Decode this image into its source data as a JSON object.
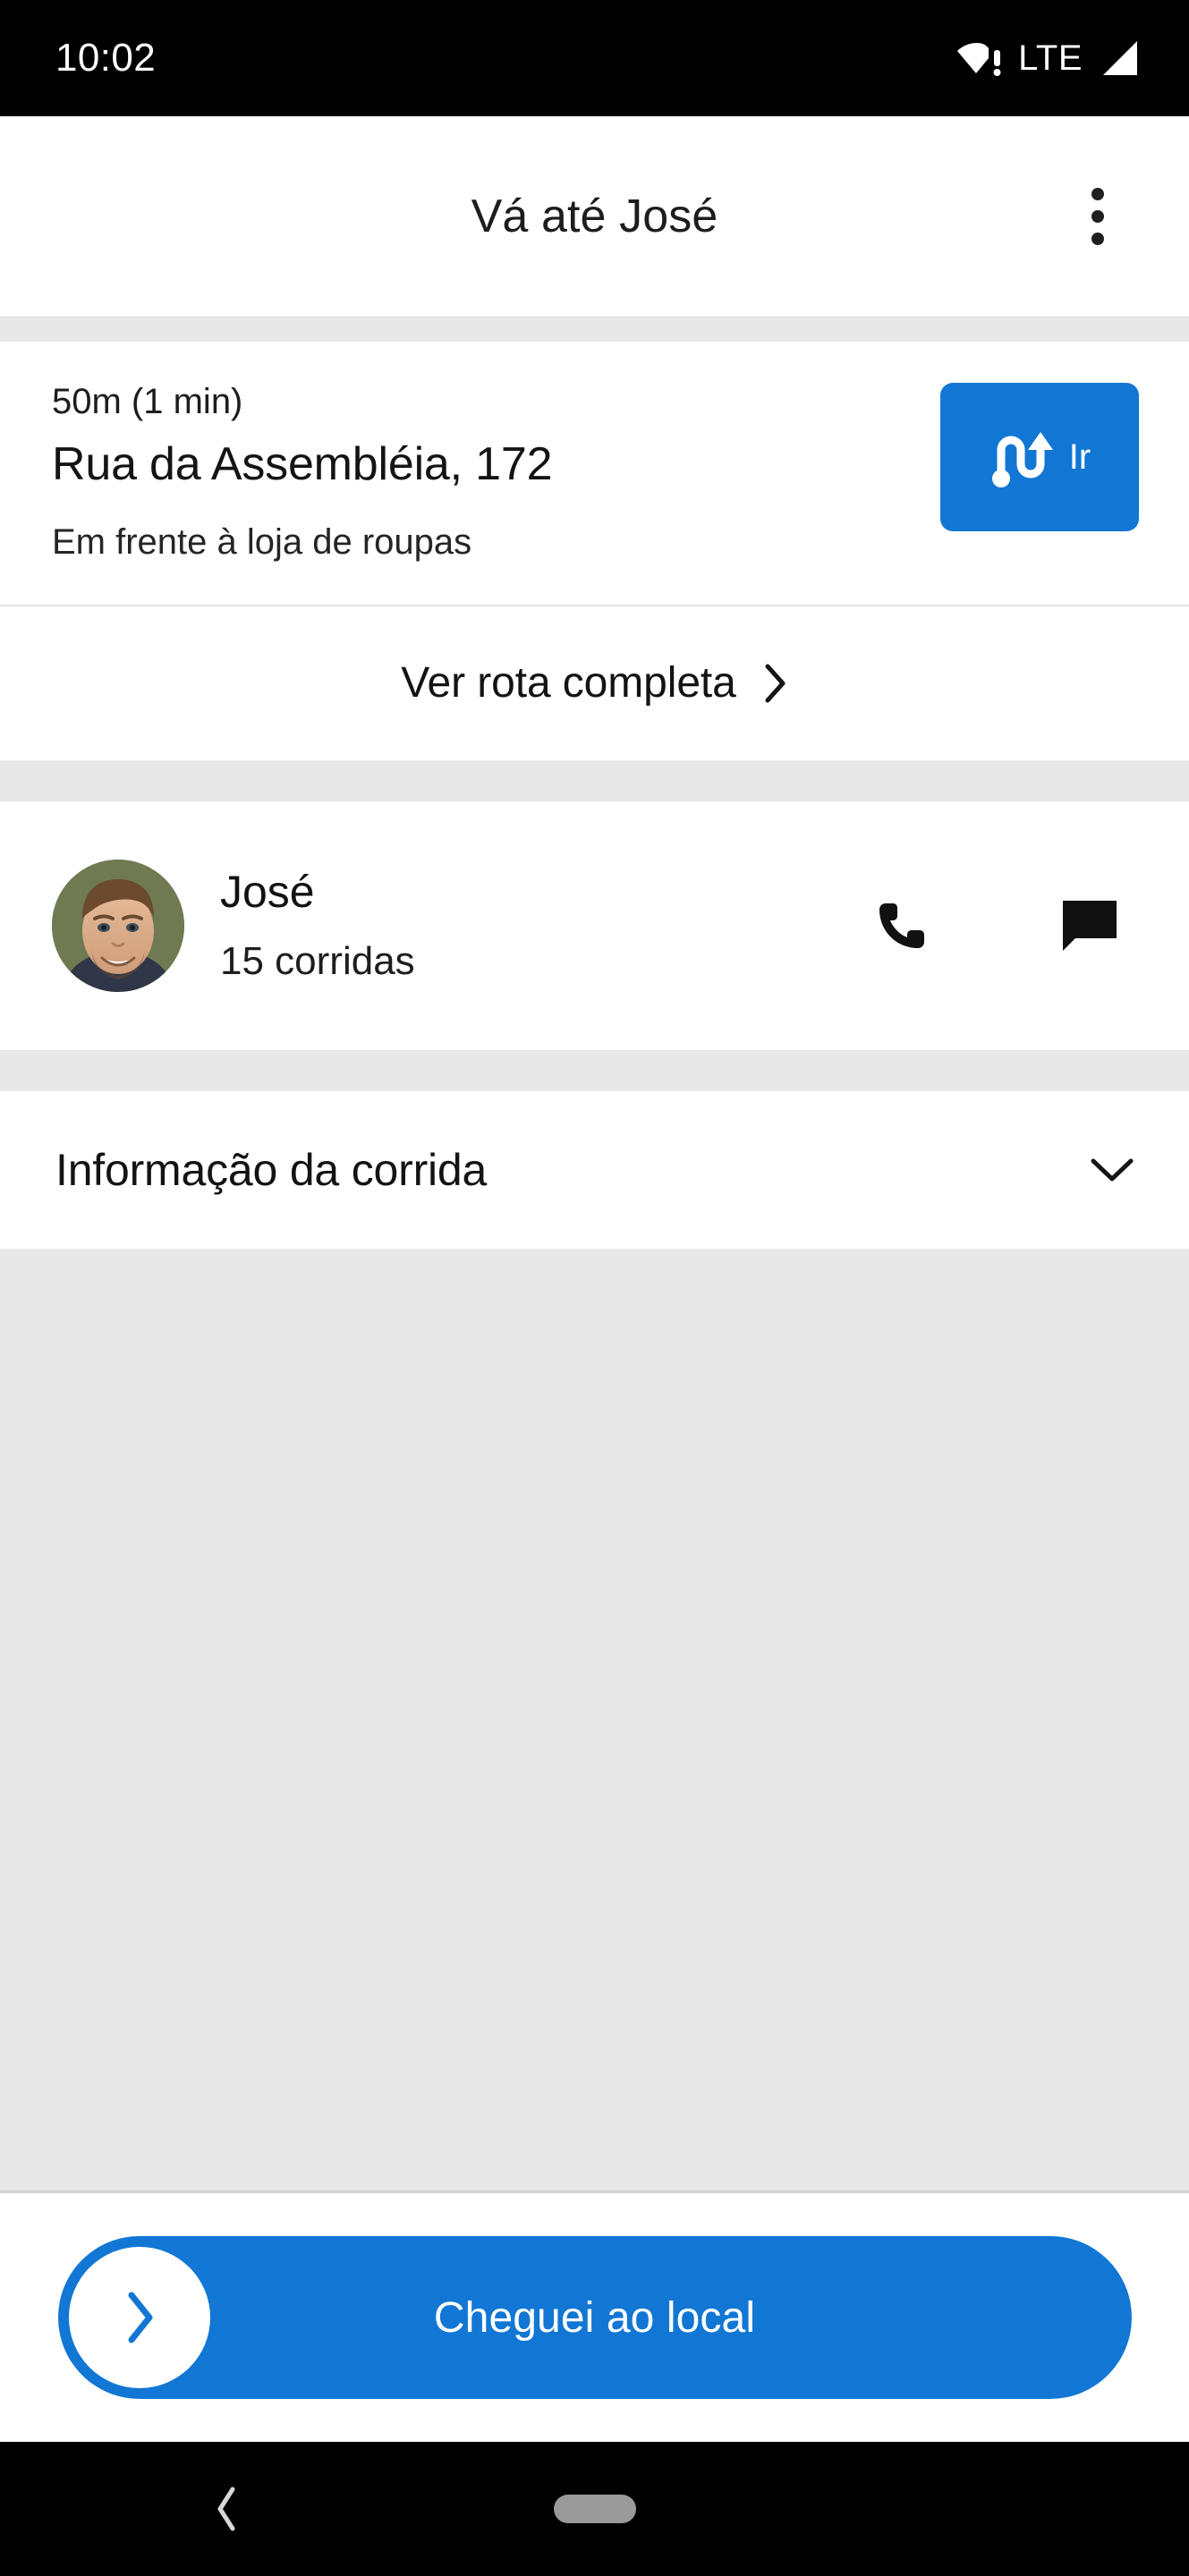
{
  "status_bar": {
    "time": "10:02",
    "network_label": "LTE",
    "wifi_icon": "wifi-no-internet-icon",
    "signal_icon": "cellular-signal-icon"
  },
  "app_bar": {
    "title": "Vá até José",
    "overflow_icon": "more-vertical-icon"
  },
  "address_card": {
    "eta": "50m (1 min)",
    "street": "Rua da Assembléia, 172",
    "note": "Em frente à loja de roupas",
    "go_button_label": "Ir",
    "go_button_icon": "navigation-route-icon",
    "go_button_color": "#1277d4"
  },
  "route_row": {
    "label": "Ver rota completa",
    "chevron_icon": "chevron-right-icon"
  },
  "driver_card": {
    "name": "José",
    "rides": "15 corridas",
    "avatar_icon": "user-photo-avatar",
    "call_icon": "phone-icon",
    "message_icon": "chat-bubble-icon"
  },
  "ride_info": {
    "label": "Informação da corrida",
    "chevron_icon": "chevron-down-icon"
  },
  "cta": {
    "label": "Cheguei ao local",
    "thumb_icon": "chevron-right-icon",
    "color": "#1277d4"
  },
  "nav_bar": {
    "back_icon": "back-chevron-icon",
    "home_icon": "home-pill-icon"
  }
}
